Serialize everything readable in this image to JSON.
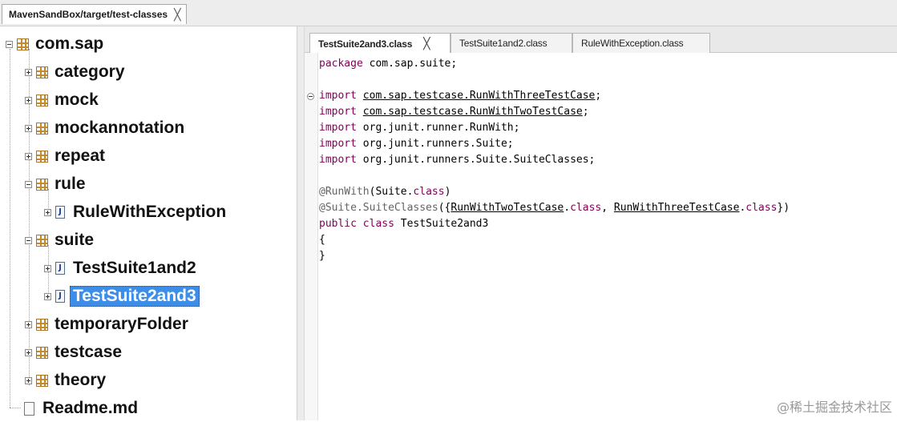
{
  "top_tab": {
    "title": "MavenSandBox/target/test-classes",
    "close": "╳"
  },
  "tree": {
    "root": "com.sap",
    "items": [
      "category",
      "mock",
      "mockannotation",
      "repeat",
      "rule",
      "RuleWithException",
      "suite",
      "TestSuite1and2",
      "TestSuite2and3",
      "temporaryFolder",
      "testcase",
      "theory"
    ],
    "readme": "Readme.md",
    "file_glyph": "J"
  },
  "editor": {
    "tabs": [
      {
        "label": "TestSuite2and3.class",
        "close": "╳"
      },
      {
        "label": "TestSuite1and2.class"
      },
      {
        "label": "RuleWithException.class"
      }
    ],
    "code": {
      "l1": {
        "kw": "package",
        "rest": " com.sap.suite;"
      },
      "l3": {
        "kw": "import",
        "ref": "com.sap.testcase.RunWithThreeTestCase",
        "end": ";"
      },
      "l4": {
        "kw": "import",
        "ref": "com.sap.testcase.RunWithTwoTestCase",
        "end": ";"
      },
      "l5": {
        "kw": "import",
        "rest": " org.junit.runner.RunWith;"
      },
      "l6": {
        "kw": "import",
        "rest": " org.junit.runners.Suite;"
      },
      "l7": {
        "kw": "import",
        "rest": " org.junit.runners.Suite.SuiteClasses;"
      },
      "l9": {
        "ann": "@RunWith",
        "a": "(Suite.",
        "kw": "class",
        "b": ")"
      },
      "l10": {
        "ann": "@Suite.SuiteClasses",
        "a": "({",
        "ref1": "RunWithTwoTestCase",
        "dot": ".",
        "kw": "class",
        "sep": ", ",
        "ref2": "RunWithThreeTestCase",
        "end": "})"
      },
      "l11": {
        "kw1": "public",
        "kw2": "class",
        "name": " TestSuite2and3"
      },
      "l12": "{",
      "l13": "}"
    }
  },
  "watermark": "@稀土掘金技术社区"
}
